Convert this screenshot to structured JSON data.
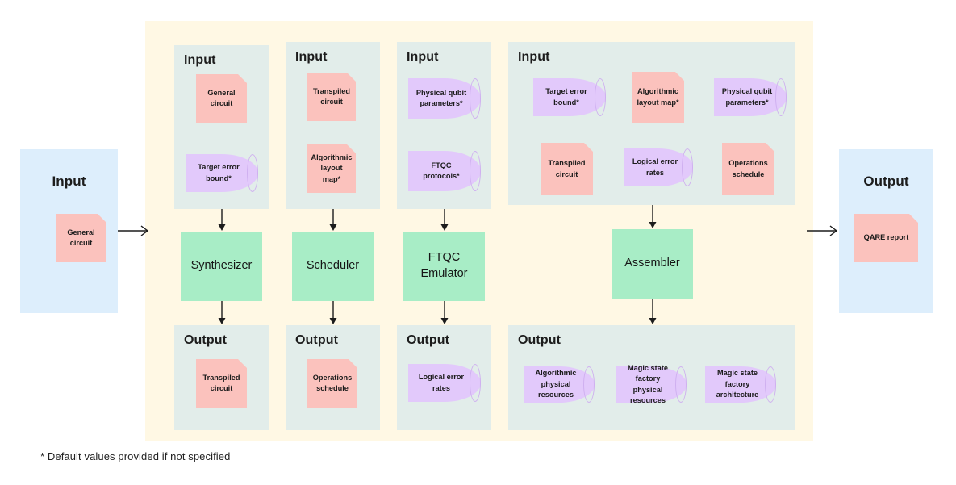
{
  "footnote": "* Default values provided if not specified",
  "colors": {
    "cream_panel": "#fff8e4",
    "io_panel": "#ddeefc",
    "section_panel": "#e2edea",
    "document": "#fbc2bd",
    "datastore": "#e2c9fb",
    "process": "#a8edc6",
    "arrow": "#1c1c1c"
  },
  "global_input": {
    "title": "Input",
    "items": [
      {
        "label": "General circuit",
        "shape": "document"
      }
    ]
  },
  "global_output": {
    "title": "Output",
    "items": [
      {
        "label": "QARE report",
        "shape": "document"
      }
    ]
  },
  "stages": [
    {
      "name": "Synthesizer",
      "input_title": "Input",
      "inputs": [
        {
          "label": "General circuit",
          "shape": "document"
        },
        {
          "label": "Target error bound*",
          "shape": "datastore"
        }
      ],
      "output_title": "Output",
      "outputs": [
        {
          "label": "Transpiled circuit",
          "shape": "document"
        }
      ]
    },
    {
      "name": "Scheduler",
      "input_title": "Input",
      "inputs": [
        {
          "label": "Transpiled circuit",
          "shape": "document"
        },
        {
          "label": "Algorithmic layout map*",
          "shape": "document"
        }
      ],
      "output_title": "Output",
      "outputs": [
        {
          "label": "Operations schedule",
          "shape": "document"
        }
      ]
    },
    {
      "name": "FTQC Emulator",
      "input_title": "Input",
      "inputs": [
        {
          "label": "Physical qubit parameters*",
          "shape": "datastore"
        },
        {
          "label": "FTQC protocols*",
          "shape": "datastore"
        }
      ],
      "output_title": "Output",
      "outputs": [
        {
          "label": "Logical error rates",
          "shape": "datastore"
        }
      ]
    },
    {
      "name": "Assembler",
      "input_title": "Input",
      "inputs": [
        {
          "label": "Target error bound*",
          "shape": "datastore"
        },
        {
          "label": "Algorithmic layout map*",
          "shape": "document"
        },
        {
          "label": "Physical qubit parameters*",
          "shape": "datastore"
        },
        {
          "label": "Transpiled circuit",
          "shape": "document"
        },
        {
          "label": "Logical error rates",
          "shape": "datastore"
        },
        {
          "label": "Operations schedule",
          "shape": "document"
        }
      ],
      "output_title": "Output",
      "outputs": [
        {
          "label": "Algorithmic physical resources",
          "shape": "datastore"
        },
        {
          "label": "Magic state factory physical resources",
          "shape": "datastore"
        },
        {
          "label": "Magic state factory architecture",
          "shape": "datastore"
        }
      ]
    }
  ]
}
